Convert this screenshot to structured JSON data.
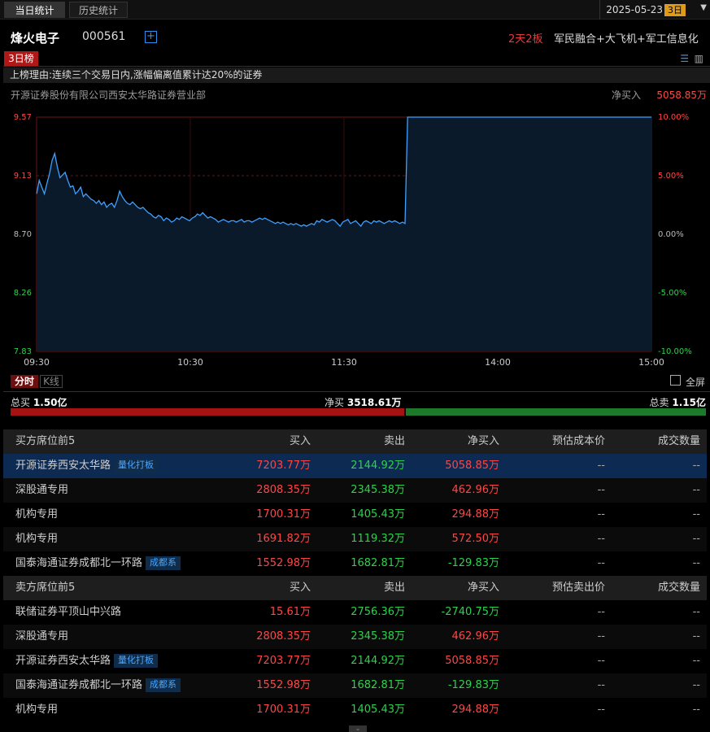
{
  "topbar": {
    "tabs": [
      "当日统计",
      "历史统计"
    ],
    "date": "2025-05-23",
    "badge": "3日",
    "dropdown": "▼"
  },
  "header": {
    "stock_name": "烽火电子",
    "stock_code": "000561",
    "plus_icon": "+",
    "boards": "2天2板",
    "concepts": "军民融合+大飞机+军工信息化"
  },
  "rank": {
    "badge": "3日榜",
    "reason": "上榜理由:连续三个交易日内,涨幅偏离值累计达20%的证券",
    "broker": "开源证券股份有限公司西安太华路证券营业部",
    "net_buy_label": "净买入",
    "net_buy_value": "5058.85万"
  },
  "chart_data": {
    "type": "line",
    "ylabels_left": [
      "9.57",
      "9.13",
      "8.70",
      "8.26",
      "7.83"
    ],
    "ylabels_right": [
      "10.00%",
      "5.00%",
      "0.00%",
      "-5.00%",
      "-10.00%"
    ],
    "xlabels": [
      "09:30",
      "10:30",
      "11:30",
      "14:00",
      "15:00"
    ],
    "ylim": [
      7.83,
      9.57
    ],
    "prev_close": 8.7,
    "minutes_total": 240,
    "series": [
      {
        "values": [
          9.0,
          9.1,
          9.05,
          9.0,
          9.08,
          9.15,
          9.25,
          9.3,
          9.2,
          9.12,
          9.14,
          9.16,
          9.1,
          9.05,
          9.06,
          9.0,
          9.02,
          9.05,
          8.98,
          9.0,
          8.98,
          8.96,
          8.95,
          8.93,
          8.95,
          8.92,
          8.94,
          8.9,
          8.92,
          8.93,
          8.9,
          8.95,
          9.02,
          8.98,
          8.95,
          8.93,
          8.92,
          8.94,
          8.92,
          8.9,
          8.89,
          8.9,
          8.88,
          8.86,
          8.85,
          8.83,
          8.82,
          8.84,
          8.83,
          8.8,
          8.82,
          8.81,
          8.79,
          8.8,
          8.82,
          8.81,
          8.83,
          8.82,
          8.81,
          8.8,
          8.82,
          8.83,
          8.85,
          8.84,
          8.86,
          8.84,
          8.82,
          8.83,
          8.82,
          8.81,
          8.79,
          8.8,
          8.81,
          8.8,
          8.79,
          8.8,
          8.8,
          8.79,
          8.8,
          8.81,
          8.79,
          8.8,
          8.8,
          8.79,
          8.8,
          8.81,
          8.82,
          8.81,
          8.82,
          8.81,
          8.8,
          8.79,
          8.78,
          8.79,
          8.78,
          8.79,
          8.78,
          8.77,
          8.78,
          8.77,
          8.78,
          8.77,
          8.76,
          8.77,
          8.76,
          8.77,
          8.78,
          8.77,
          8.8,
          8.79,
          8.81,
          8.8,
          8.79,
          8.8,
          8.81,
          8.8,
          8.78,
          8.76,
          8.79,
          8.8,
          8.81,
          8.78,
          8.79,
          8.8,
          8.78,
          8.76,
          8.79,
          8.8,
          8.79,
          8.78,
          8.8,
          8.79,
          8.8,
          8.79,
          8.78,
          8.79,
          8.8,
          8.79,
          8.8,
          8.79,
          8.78,
          8.79,
          8.78,
          9.57,
          9.57,
          9.57,
          9.57,
          9.57,
          9.57,
          9.57,
          9.57,
          9.57,
          9.57,
          9.57,
          9.57,
          9.57,
          9.57,
          9.57,
          9.57,
          9.57,
          9.57,
          9.57,
          9.57,
          9.57,
          9.57,
          9.57,
          9.57,
          9.57,
          9.57,
          9.57,
          9.57,
          9.57,
          9.57,
          9.57,
          9.57,
          9.57,
          9.57,
          9.57,
          9.57,
          9.57,
          9.57,
          9.57,
          9.57,
          9.57,
          9.57,
          9.57,
          9.57,
          9.57,
          9.57,
          9.57,
          9.57,
          9.57,
          9.57,
          9.57,
          9.57,
          9.57,
          9.57,
          9.57,
          9.57,
          9.57,
          9.57,
          9.57,
          9.57,
          9.57,
          9.57,
          9.57,
          9.57,
          9.57,
          9.57,
          9.57,
          9.57,
          9.57,
          9.57,
          9.57,
          9.57,
          9.57,
          9.57,
          9.57,
          9.57,
          9.57,
          9.57,
          9.57,
          9.57,
          9.57,
          9.57,
          9.57,
          9.57,
          9.57,
          9.57,
          9.57,
          9.57,
          9.57,
          9.57,
          9.57,
          9.57,
          9.57,
          9.57,
          9.57
        ]
      }
    ],
    "line_color": "#3ea0ff",
    "grid": true
  },
  "modes": {
    "active": "分时",
    "inactive": "K线",
    "fullscreen": "全屏"
  },
  "summary": {
    "total_buy_label": "总买",
    "total_buy": "1.50亿",
    "net_buy_label": "净买",
    "net_buy": "3518.61万",
    "total_sell_label": "总卖",
    "total_sell": "1.15亿",
    "buy_fraction": 0.566
  },
  "buy_table": {
    "headers": [
      "买方席位前5",
      "买入",
      "卖出",
      "净买入",
      "预估成本价",
      "成交数量"
    ],
    "rows": [
      {
        "name": "开源证券西安太华路",
        "tag": "量化打板",
        "buy": "7203.77万",
        "sell": "2144.92万",
        "net": "5058.85万",
        "price": "--",
        "qty": "--"
      },
      {
        "name": "深股通专用",
        "tag": "",
        "buy": "2808.35万",
        "sell": "2345.38万",
        "net": "462.96万",
        "price": "--",
        "qty": "--"
      },
      {
        "name": "机构专用",
        "tag": "",
        "buy": "1700.31万",
        "sell": "1405.43万",
        "net": "294.88万",
        "price": "--",
        "qty": "--"
      },
      {
        "name": "机构专用",
        "tag": "",
        "buy": "1691.82万",
        "sell": "1119.32万",
        "net": "572.50万",
        "price": "--",
        "qty": "--"
      },
      {
        "name": "国泰海通证券成都北一环路",
        "tag": "成都系",
        "buy": "1552.98万",
        "sell": "1682.81万",
        "net": "-129.83万",
        "price": "--",
        "qty": "--"
      }
    ]
  },
  "sell_table": {
    "headers": [
      "卖方席位前5",
      "买入",
      "卖出",
      "净买入",
      "预估卖出价",
      "成交数量"
    ],
    "rows": [
      {
        "name": "联储证券平顶山中兴路",
        "tag": "",
        "buy": "15.61万",
        "sell": "2756.36万",
        "net": "-2740.75万",
        "price": "--",
        "qty": "--"
      },
      {
        "name": "深股通专用",
        "tag": "",
        "buy": "2808.35万",
        "sell": "2345.38万",
        "net": "462.96万",
        "price": "--",
        "qty": "--"
      },
      {
        "name": "开源证券西安太华路",
        "tag": "量化打板",
        "buy": "7203.77万",
        "sell": "2144.92万",
        "net": "5058.85万",
        "price": "--",
        "qty": "--"
      },
      {
        "name": "国泰海通证券成都北一环路",
        "tag": "成都系",
        "buy": "1552.98万",
        "sell": "1682.81万",
        "net": "-129.83万",
        "price": "--",
        "qty": "--"
      },
      {
        "name": "机构专用",
        "tag": "",
        "buy": "1700.31万",
        "sell": "1405.43万",
        "net": "294.88万",
        "price": "--",
        "qty": "--"
      }
    ]
  },
  "colors": {
    "up": "#ff4646",
    "down": "#2bd34a",
    "accent": "#2f8fe8",
    "badge": "#e09a1a"
  }
}
